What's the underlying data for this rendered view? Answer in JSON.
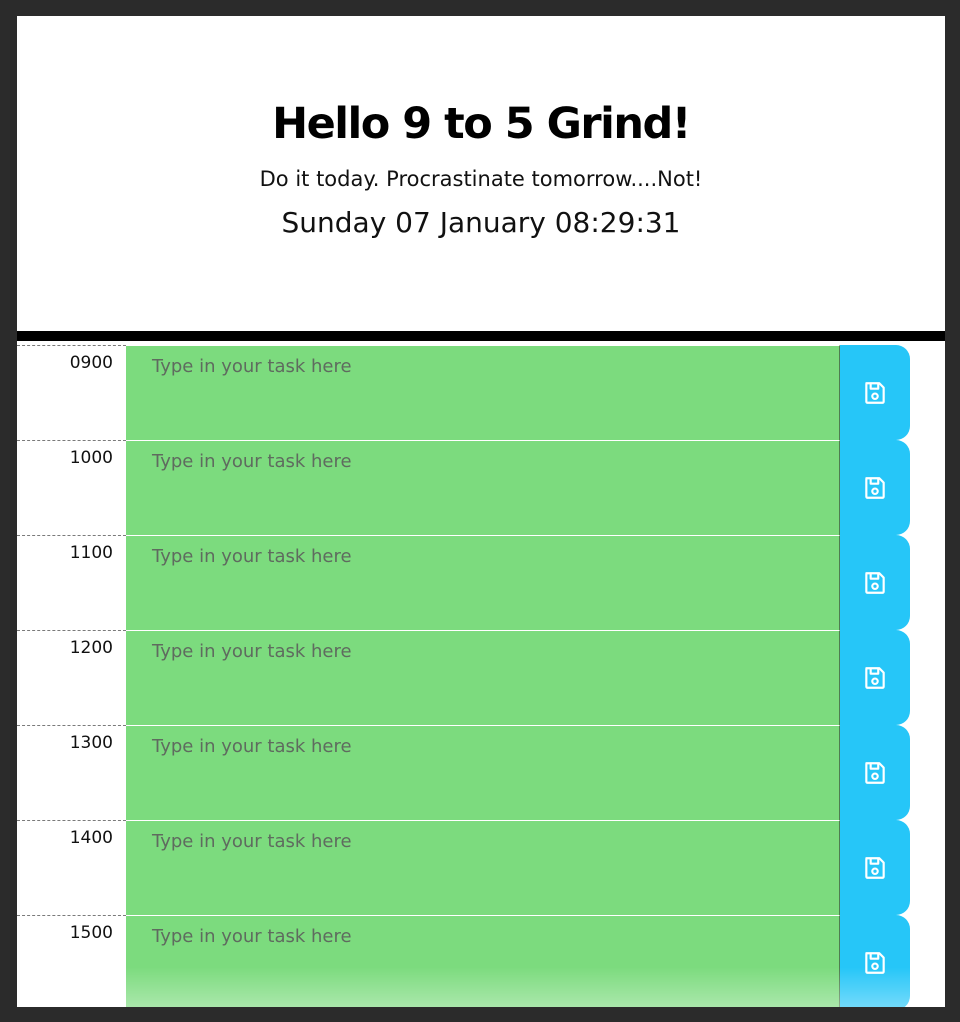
{
  "header": {
    "title": "Hello 9 to 5 Grind!",
    "tagline": "Do it today. Procrastinate tomorrow....Not!",
    "datetime": "Sunday 07 January 08:29:31"
  },
  "colors": {
    "future_block": "#7cdb7e",
    "save_button": "#26c6f8",
    "divider": "#000000"
  },
  "task_placeholder": "Type in your task here",
  "save_icon": "floppy-disk-icon",
  "hours": [
    {
      "label": "0900",
      "value": ""
    },
    {
      "label": "1000",
      "value": ""
    },
    {
      "label": "1100",
      "value": ""
    },
    {
      "label": "1200",
      "value": ""
    },
    {
      "label": "1300",
      "value": ""
    },
    {
      "label": "1400",
      "value": ""
    },
    {
      "label": "1500",
      "value": ""
    }
  ]
}
